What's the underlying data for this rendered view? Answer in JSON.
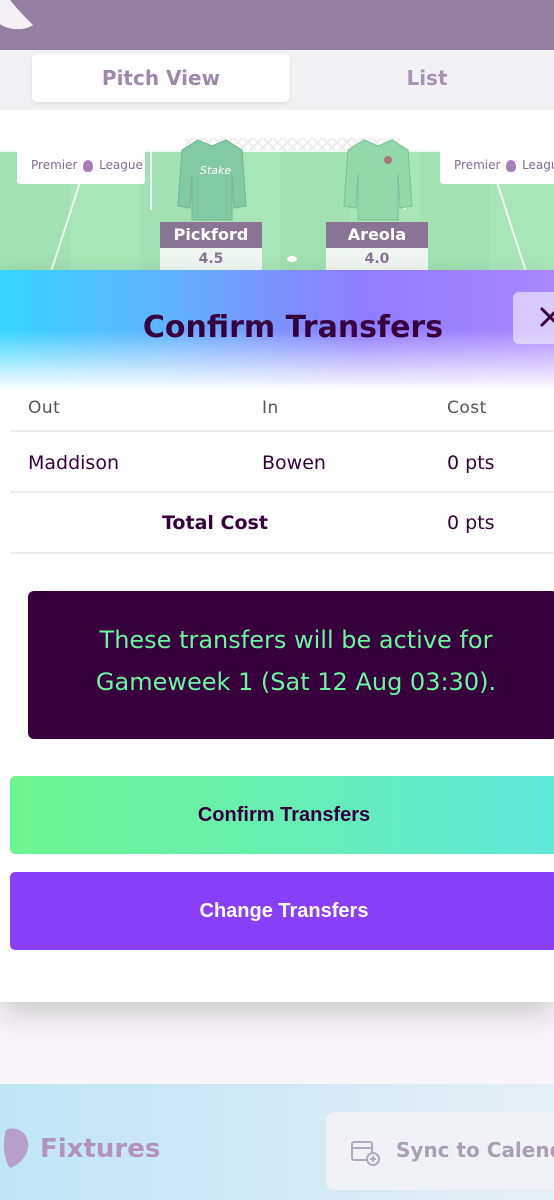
{
  "background": {
    "tabs": [
      {
        "label": "Pitch View"
      },
      {
        "label": "List"
      }
    ],
    "boards": [
      {
        "text_a": "Premier",
        "text_b": "League"
      },
      {
        "text_a": "Premier",
        "text_b": "League"
      }
    ],
    "players": [
      {
        "name": "Pickford",
        "price": "4.5"
      },
      {
        "name": "Areola",
        "price": "4.0"
      }
    ],
    "bottom": {
      "fixtures_label": "Fixtures",
      "sync_label": "Sync to Calend"
    }
  },
  "modal": {
    "title": "Confirm Transfers",
    "columns": {
      "out": "Out",
      "in": "In",
      "cost": "Cost"
    },
    "transfer": {
      "out": "Maddison",
      "in": "Bowen",
      "cost": "0 pts"
    },
    "total": {
      "label": "Total Cost",
      "value": "0 pts"
    },
    "info": "These transfers will be active for Gameweek 1 (Sat 12 Aug 03:30).",
    "confirm_label": "Confirm Transfers",
    "change_label": "Change Transfers"
  },
  "colors": {
    "brand_purple": "#37003c",
    "accent_green": "#6cf5a0",
    "change_button": "#8a3ff9"
  }
}
